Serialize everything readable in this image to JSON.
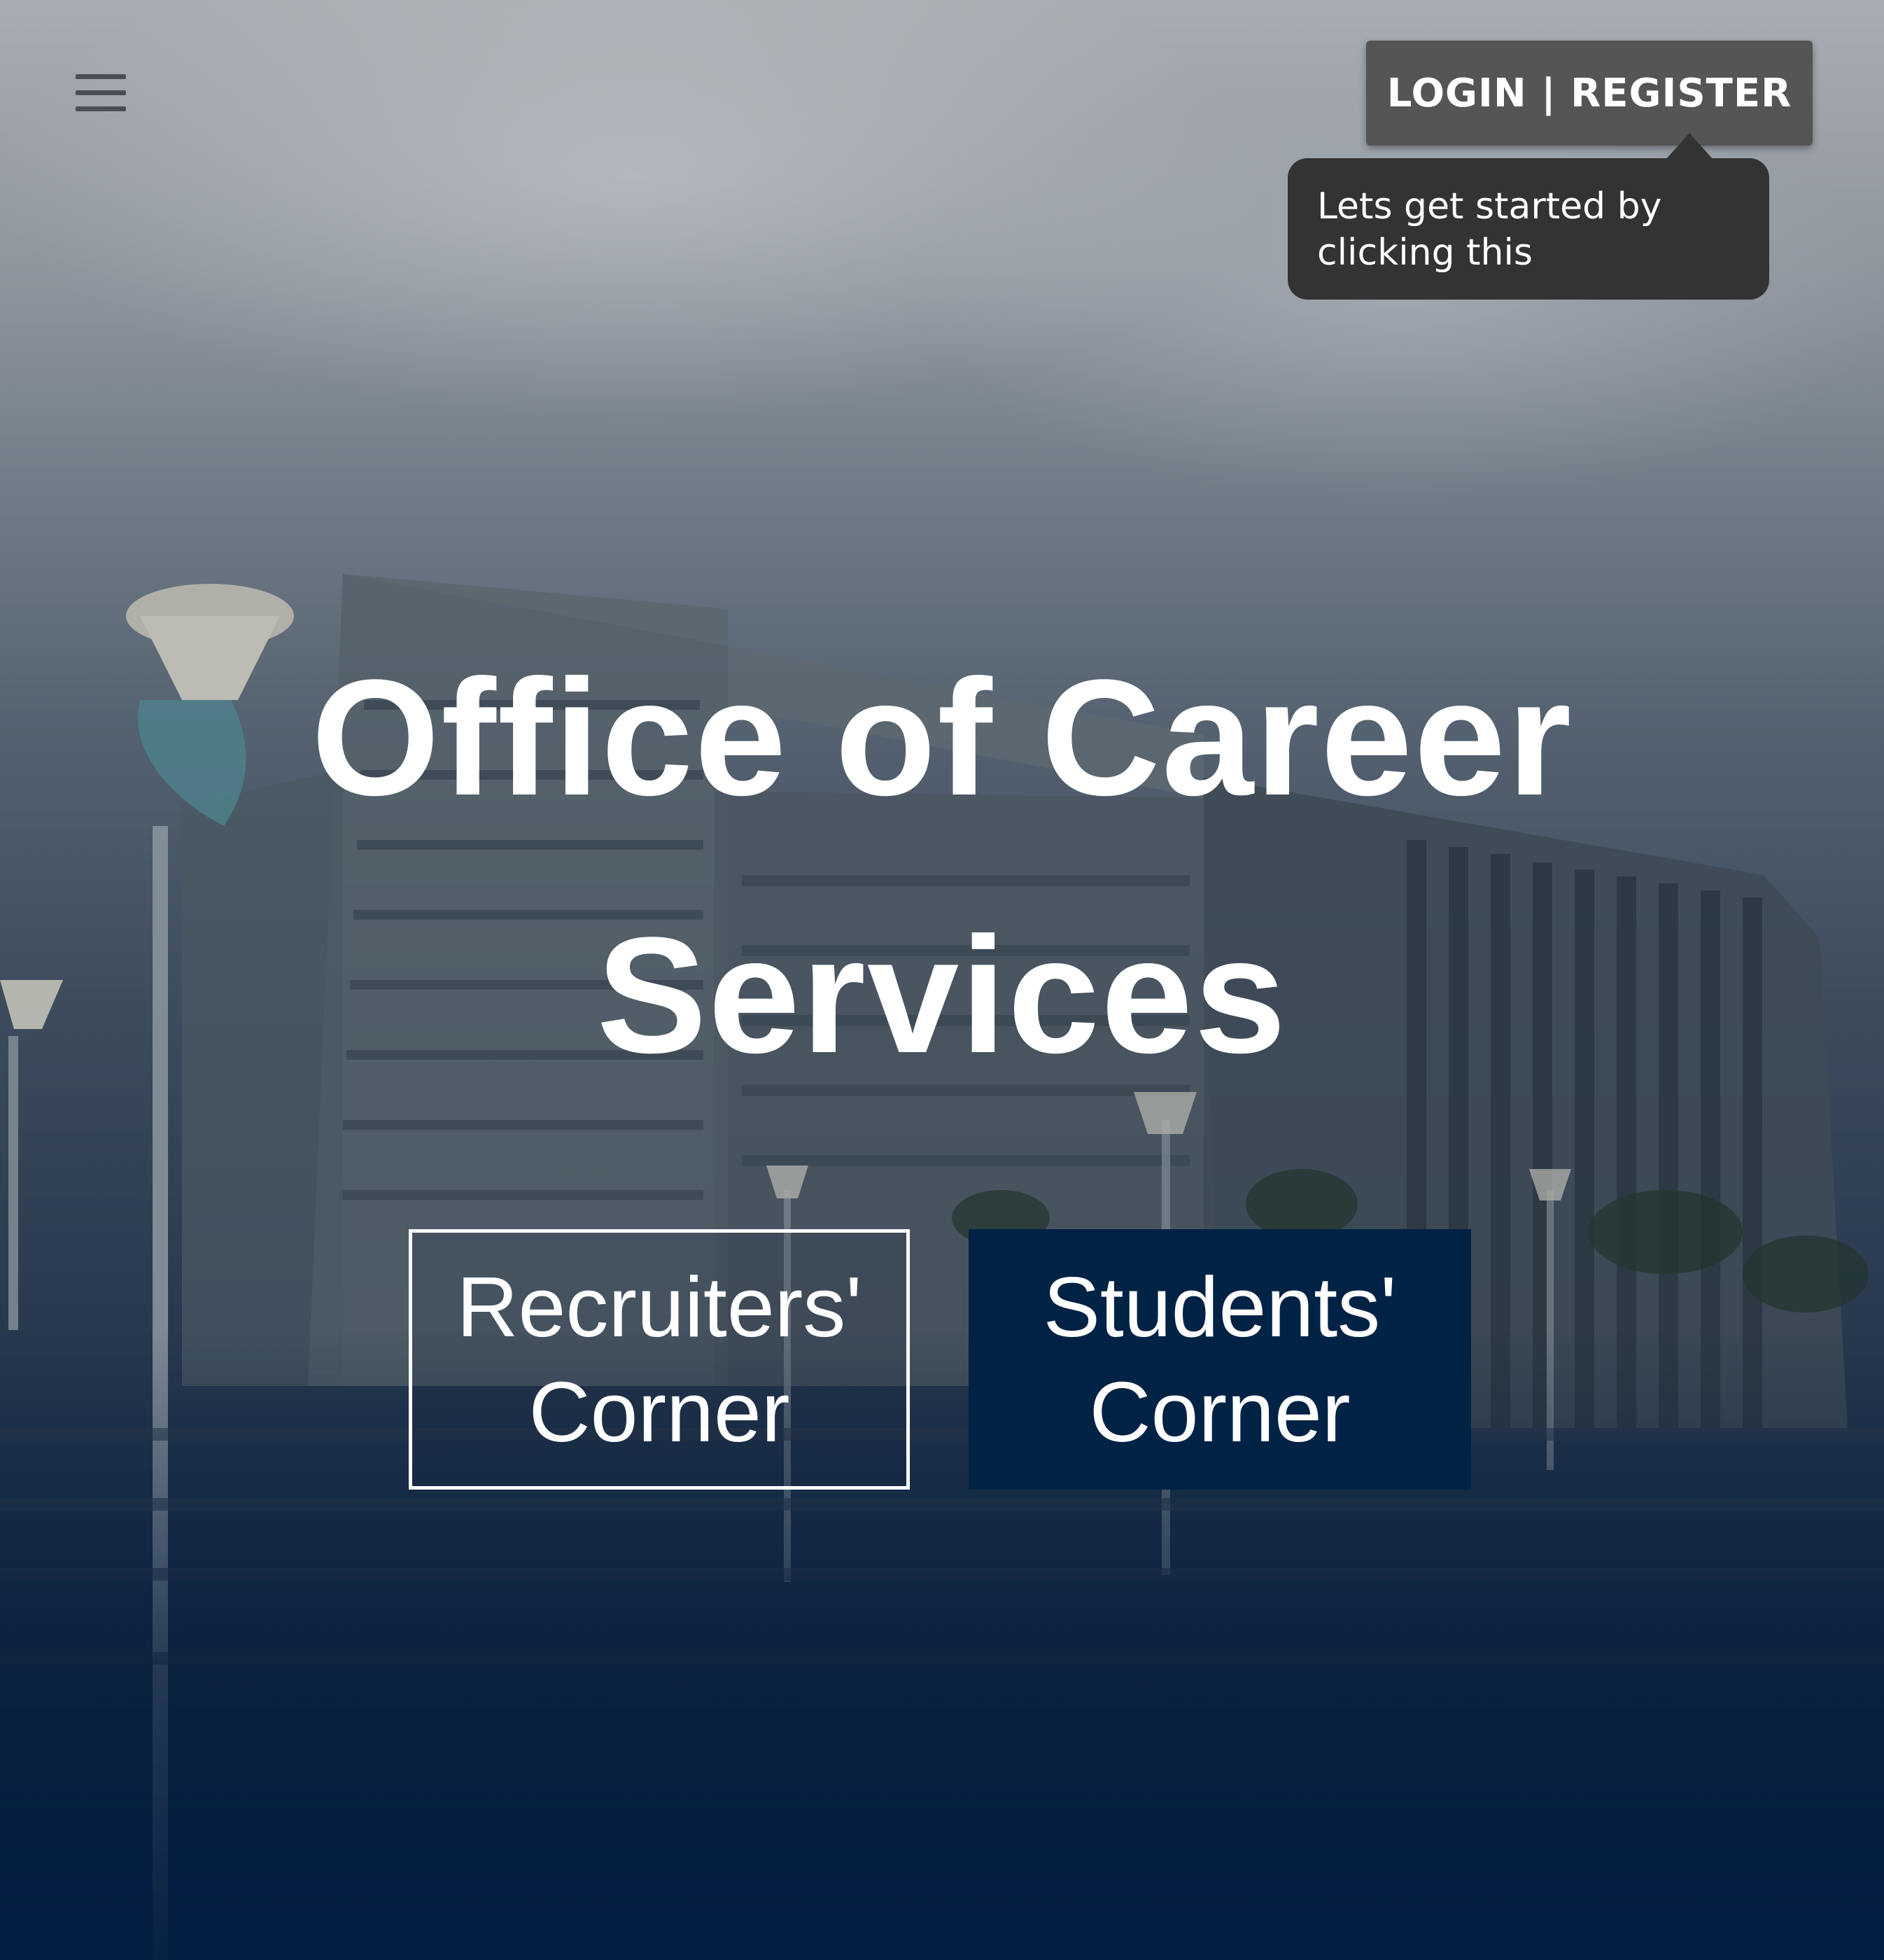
{
  "header": {
    "menu_icon": "hamburger-menu-icon",
    "login_label": "LOGIN | REGISTER",
    "tooltip_text": "Lets get started by clicking this"
  },
  "hero": {
    "title_line1": "Office of Career",
    "title_line2": "Services",
    "recruiters_line1": "Recruiters'",
    "recruiters_line2": "Corner",
    "students_line1": "Students'",
    "students_line2": "Corner"
  },
  "colors": {
    "login_bg": "#555555",
    "tooltip_bg": "#333333",
    "students_bg": "#002244",
    "text": "#ffffff"
  }
}
